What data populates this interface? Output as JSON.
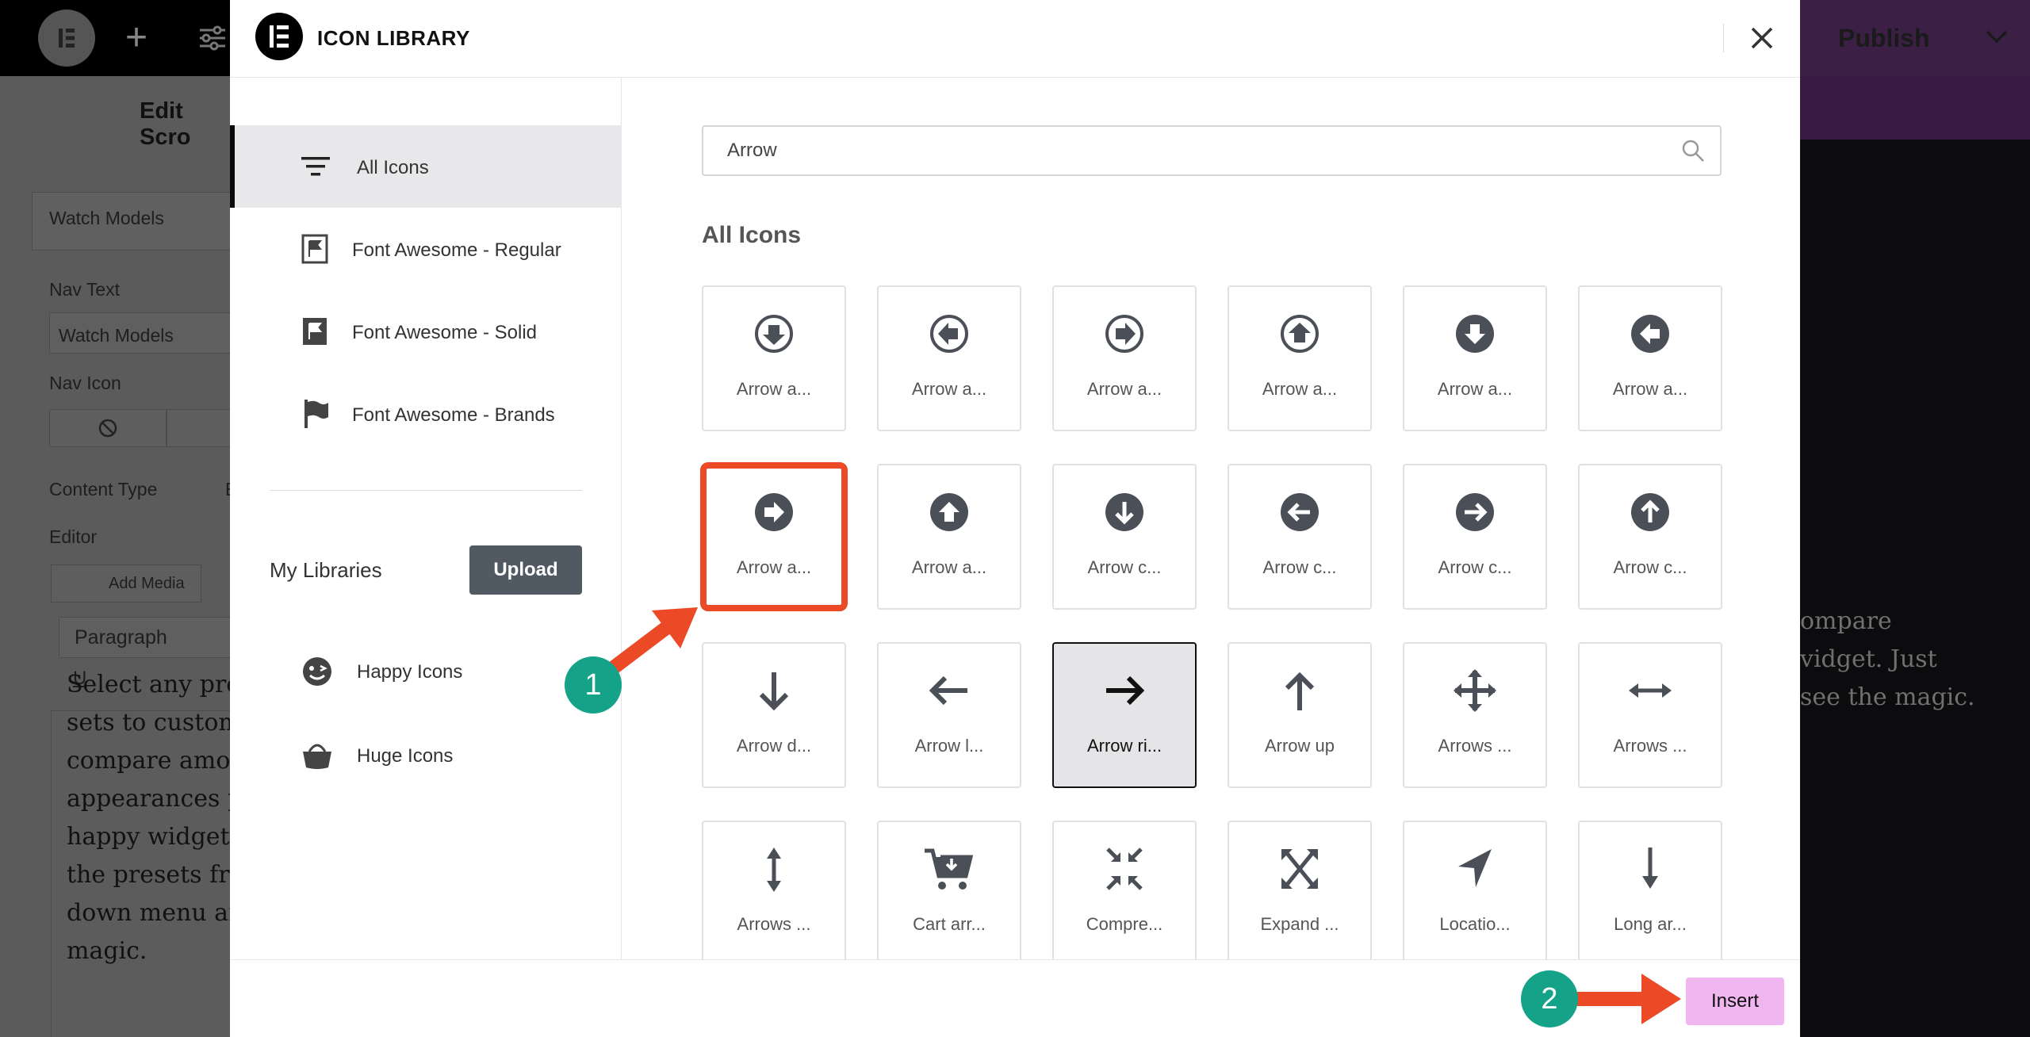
{
  "background": {
    "panel_title": "Edit Scro",
    "widget_box_label": "Watch Models",
    "nav_text_label": "Nav Text",
    "nav_text_value": "Watch Models",
    "nav_icon_label": "Nav Icon",
    "content_type_label": "Content Type",
    "content_type_value": "E",
    "editor_label": "Editor",
    "add_media_label": "Add Media",
    "paragraph_label": "Paragraph",
    "paragraph_text": "Select any pre-\nsets to customi\ncompare amor\nappearances pe\nhappy widget.\nthe presets fro\ndown menu an\nmagic.",
    "publish_label": "Publish",
    "preview_text": "ompare\nvidget. Just\nsee the magic."
  },
  "modal": {
    "title": "ICON LIBRARY",
    "categories": [
      {
        "label": "All Icons",
        "icon": "filter-lines-icon",
        "active": true
      },
      {
        "label": "Font Awesome - Regular",
        "icon": "flag-regular-icon"
      },
      {
        "label": "Font Awesome - Solid",
        "icon": "flag-solid-icon"
      },
      {
        "label": "Font Awesome - Brands",
        "icon": "flag-brands-icon"
      }
    ],
    "my_libraries_label": "My Libraries",
    "upload_label": "Upload",
    "libraries": [
      {
        "label": "Happy Icons",
        "icon": "happy-face-icon"
      },
      {
        "label": "Huge Icons",
        "icon": "basket-icon"
      }
    ],
    "search": {
      "value": "Arrow",
      "placeholder": "Search"
    },
    "section_title": "All Icons",
    "icons": [
      {
        "label": "Arrow a...",
        "icon": "arrow-alt-circle-down-regular-icon"
      },
      {
        "label": "Arrow a...",
        "icon": "arrow-alt-circle-left-regular-icon"
      },
      {
        "label": "Arrow a...",
        "icon": "arrow-alt-circle-right-regular-icon"
      },
      {
        "label": "Arrow a...",
        "icon": "arrow-alt-circle-up-regular-icon"
      },
      {
        "label": "Arrow a...",
        "icon": "arrow-alt-circle-down-solid-icon"
      },
      {
        "label": "Arrow a...",
        "icon": "arrow-alt-circle-left-solid-icon"
      },
      {
        "label": "Arrow a...",
        "icon": "arrow-alt-circle-right-solid-icon"
      },
      {
        "label": "Arrow a...",
        "icon": "arrow-alt-circle-up-solid-icon"
      },
      {
        "label": "Arrow c...",
        "icon": "arrow-circle-down-icon"
      },
      {
        "label": "Arrow c...",
        "icon": "arrow-circle-left-icon"
      },
      {
        "label": "Arrow c...",
        "icon": "arrow-circle-right-icon"
      },
      {
        "label": "Arrow c...",
        "icon": "arrow-circle-up-icon"
      },
      {
        "label": "Arrow d...",
        "icon": "arrow-down-icon"
      },
      {
        "label": "Arrow l...",
        "icon": "arrow-left-icon"
      },
      {
        "label": "Arrow ri...",
        "icon": "arrow-right-icon",
        "selected": true
      },
      {
        "label": "Arrow up",
        "icon": "arrow-up-icon"
      },
      {
        "label": "Arrows ...",
        "icon": "arrows-alt-icon"
      },
      {
        "label": "Arrows ...",
        "icon": "arrows-alt-h-icon"
      },
      {
        "label": "Arrows ...",
        "icon": "arrows-alt-v-icon"
      },
      {
        "label": "Cart arr...",
        "icon": "cart-arrow-down-icon"
      },
      {
        "label": "Compre...",
        "icon": "compress-arrows-alt-icon"
      },
      {
        "label": "Expand ...",
        "icon": "expand-arrows-alt-icon"
      },
      {
        "label": "Locatio...",
        "icon": "location-arrow-icon"
      },
      {
        "label": "Long ar...",
        "icon": "long-arrow-alt-down-icon"
      }
    ],
    "insert_label": "Insert"
  },
  "annotations": [
    {
      "number": "1",
      "color": "#14a389"
    },
    {
      "number": "2",
      "color": "#14a389"
    }
  ],
  "colors": {
    "accent_orange": "#ec4a26",
    "badge_teal": "#14a389",
    "insert_pink": "#f0b6f0",
    "upload_gray": "#515962"
  }
}
